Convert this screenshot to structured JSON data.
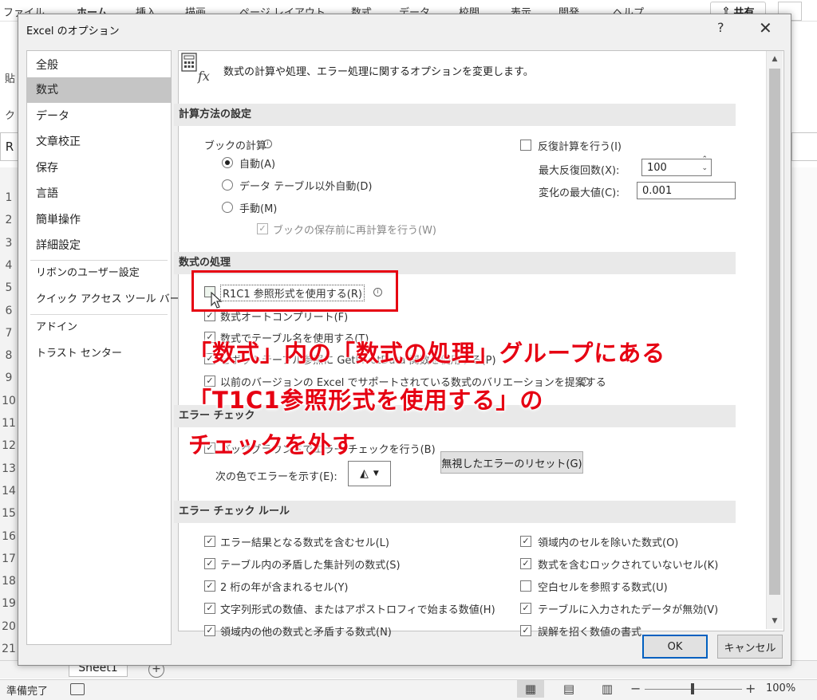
{
  "background": {
    "ribbon_tabs": [
      "ファイル",
      "ホーム",
      "挿入",
      "描画",
      "ページ レイアウト",
      "数式",
      "データ",
      "校閲",
      "表示",
      "開発",
      "ヘルプ"
    ],
    "share_label": "共有",
    "namebox": "R",
    "left_fragments": [
      "貼",
      "ク"
    ],
    "row_numbers": [
      "1",
      "2",
      "3",
      "4",
      "5",
      "6",
      "7",
      "8",
      "9",
      "10",
      "11",
      "12",
      "13",
      "14",
      "15",
      "16",
      "17",
      "18",
      "19",
      "20",
      "21"
    ],
    "sheet_tab": "Sheet1",
    "add_sheet": "+",
    "status_ready": "準備完了",
    "zoom_minus": "−",
    "zoom_plus": "+",
    "zoom_level": "100%"
  },
  "dialog": {
    "title": "Excel のオプション",
    "help": "?",
    "close": "✕",
    "nav_items": [
      "全般",
      "数式",
      "データ",
      "文章校正",
      "保存",
      "言語",
      "簡単操作",
      "詳細設定",
      "リボンのユーザー設定",
      "クイック アクセス ツール バー",
      "アドイン",
      "トラスト センター"
    ],
    "selected_nav": "数式",
    "header_text": "数式の計算や処理、エラー処理に関するオプションを変更します。",
    "calc": {
      "section": "計算方法の設定",
      "book_calc": "ブックの計算",
      "auto": "自動(A)",
      "auto_except_table": "データ テーブル以外自動(D)",
      "manual": "手動(M)",
      "recalc_before_save": "ブックの保存前に再計算を行う(W)",
      "iterative": "反復計算を行う(I)",
      "max_iter_label": "最大反復回数(X):",
      "max_iter_value": "100",
      "max_change_label": "変化の最大値(C):",
      "max_change_value": "0.001"
    },
    "formulas": {
      "section": "数式の処理",
      "r1c1": "R1C1 参照形式を使用する(R)",
      "autocomplete": "数式オートコンプリート(F)",
      "table_names": "数式でテーブル名を使用する(T)",
      "getpivot": "ピボットテーブル参照に GetPivotData 関数を使用する(P)",
      "legacy_variants": "以前のバージョンの Excel でサポートされている数式のバリエーションを提案する"
    },
    "error_check": {
      "section": "エラー チェック",
      "background": "バックグラウンドでエラー チェックを行う(B)",
      "color_label": "次の色でエラーを示す(E):",
      "reset_btn": "無視したエラーのリセット(G)"
    },
    "rules": {
      "section": "エラー チェック ルール",
      "left": [
        {
          "label": "エラー結果となる数式を含むセル(L)",
          "checked": true
        },
        {
          "label": "テーブル内の矛盾した集計列の数式(S)",
          "checked": true
        },
        {
          "label": "2 桁の年が含まれるセル(Y)",
          "checked": true
        },
        {
          "label": "文字列形式の数値、またはアポストロフィで始まる数値(H)",
          "checked": true
        },
        {
          "label": "領域内の他の数式と矛盾する数式(N)",
          "checked": true
        }
      ],
      "right": [
        {
          "label": "領域内のセルを除いた数式(O)",
          "checked": true
        },
        {
          "label": "数式を含むロックされていないセル(K)",
          "checked": true
        },
        {
          "label": "空白セルを参照する数式(U)",
          "checked": false
        },
        {
          "label": "テーブルに入力されたデータが無効(V)",
          "checked": true
        },
        {
          "label": "誤解を招く数値の書式",
          "checked": true
        }
      ]
    },
    "ok": "OK",
    "cancel": "キャンセル"
  },
  "annotation": {
    "line1": "「数式」内の「数式の処理」グループにある",
    "line2": "「T1C1参照形式を使用する」の",
    "line3": "チェックを外す",
    "color": "#e60012"
  }
}
